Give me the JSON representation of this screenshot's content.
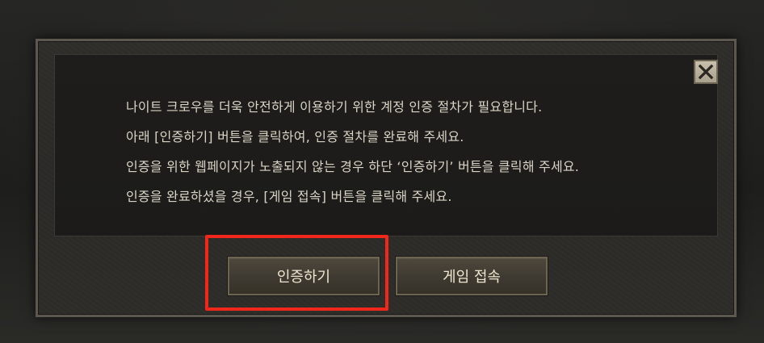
{
  "dialog": {
    "message_lines": [
      "나이트 크로우를 더욱 안전하게 이용하기 위한 계정 인증 절차가 필요합니다.",
      "아래 [인증하기] 버튼을 클릭하여, 인증 절차를 완료해 주세요.",
      "인증을 위한 웹페이지가 노출되지 않는 경우 하단 ‘인증하기’ 버튼을 클릭해 주세요.",
      "인증을 완료하셨을 경우, [게임 접속] 버튼을 클릭해 주세요."
    ],
    "close_icon": "close-icon",
    "buttons": {
      "verify_label": "인증하기",
      "connect_label": "게임 접속"
    }
  },
  "colors": {
    "highlight": "#f0271a",
    "text": "#d9d4c6",
    "button_text": "#ede5cf"
  }
}
